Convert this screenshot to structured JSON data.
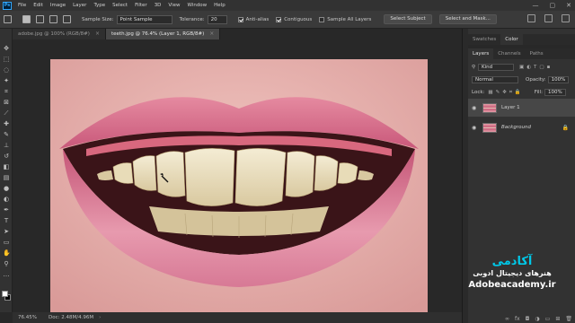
{
  "menubar": {
    "logo": "Ps",
    "items": [
      "File",
      "Edit",
      "Image",
      "Layer",
      "Type",
      "Select",
      "Filter",
      "3D",
      "View",
      "Window",
      "Help"
    ],
    "window_controls": [
      "—",
      "▢",
      "✕"
    ]
  },
  "options": {
    "sample_size_label": "Sample Size:",
    "sample_size_value": "Point Sample",
    "tolerance_label": "Tolerance:",
    "tolerance_value": "20",
    "anti_alias_label": "Anti-alias",
    "anti_alias_checked": true,
    "contiguous_label": "Contiguous",
    "contiguous_checked": true,
    "sample_all_layers_label": "Sample All Layers",
    "sample_all_layers_checked": false,
    "select_subject_label": "Select Subject",
    "select_and_mask_label": "Select and Mask..."
  },
  "tabs": [
    {
      "label": "adobe.jpg @ 100% (RGB/8#)",
      "active": false
    },
    {
      "label": "teeth.jpg @ 76.4% (Layer 1, RGB/8#)",
      "active": true
    }
  ],
  "status": {
    "zoom": "76.45%",
    "doc": "Doc: 2.48M/4.96M"
  },
  "panels": {
    "top_tabs": [
      "Swatches",
      "Color"
    ],
    "top_active": "Color",
    "layer_tabs": [
      "Layers",
      "Channels",
      "Paths"
    ],
    "layer_tabs_active": "Layers",
    "kind_label": "Kind",
    "blend_mode": "Normal",
    "opacity_label": "Opacity:",
    "opacity_value": "100%",
    "lock_label": "Lock:",
    "fill_label": "Fill:",
    "fill_value": "100%",
    "layers": [
      {
        "name": "Layer 1",
        "selected": true,
        "locked": false
      },
      {
        "name": "Background",
        "selected": false,
        "locked": true
      }
    ]
  },
  "watermark": {
    "line1": "آکادمی",
    "line2": "هنرهای دیجیتال ادوبی",
    "line3": "Adobeacademy.ir"
  },
  "colors": {
    "accent": "#31a8ff",
    "watermark_cyan": "#00c8e8",
    "lip": "#d9708c",
    "skin": "#ecb9b5"
  }
}
